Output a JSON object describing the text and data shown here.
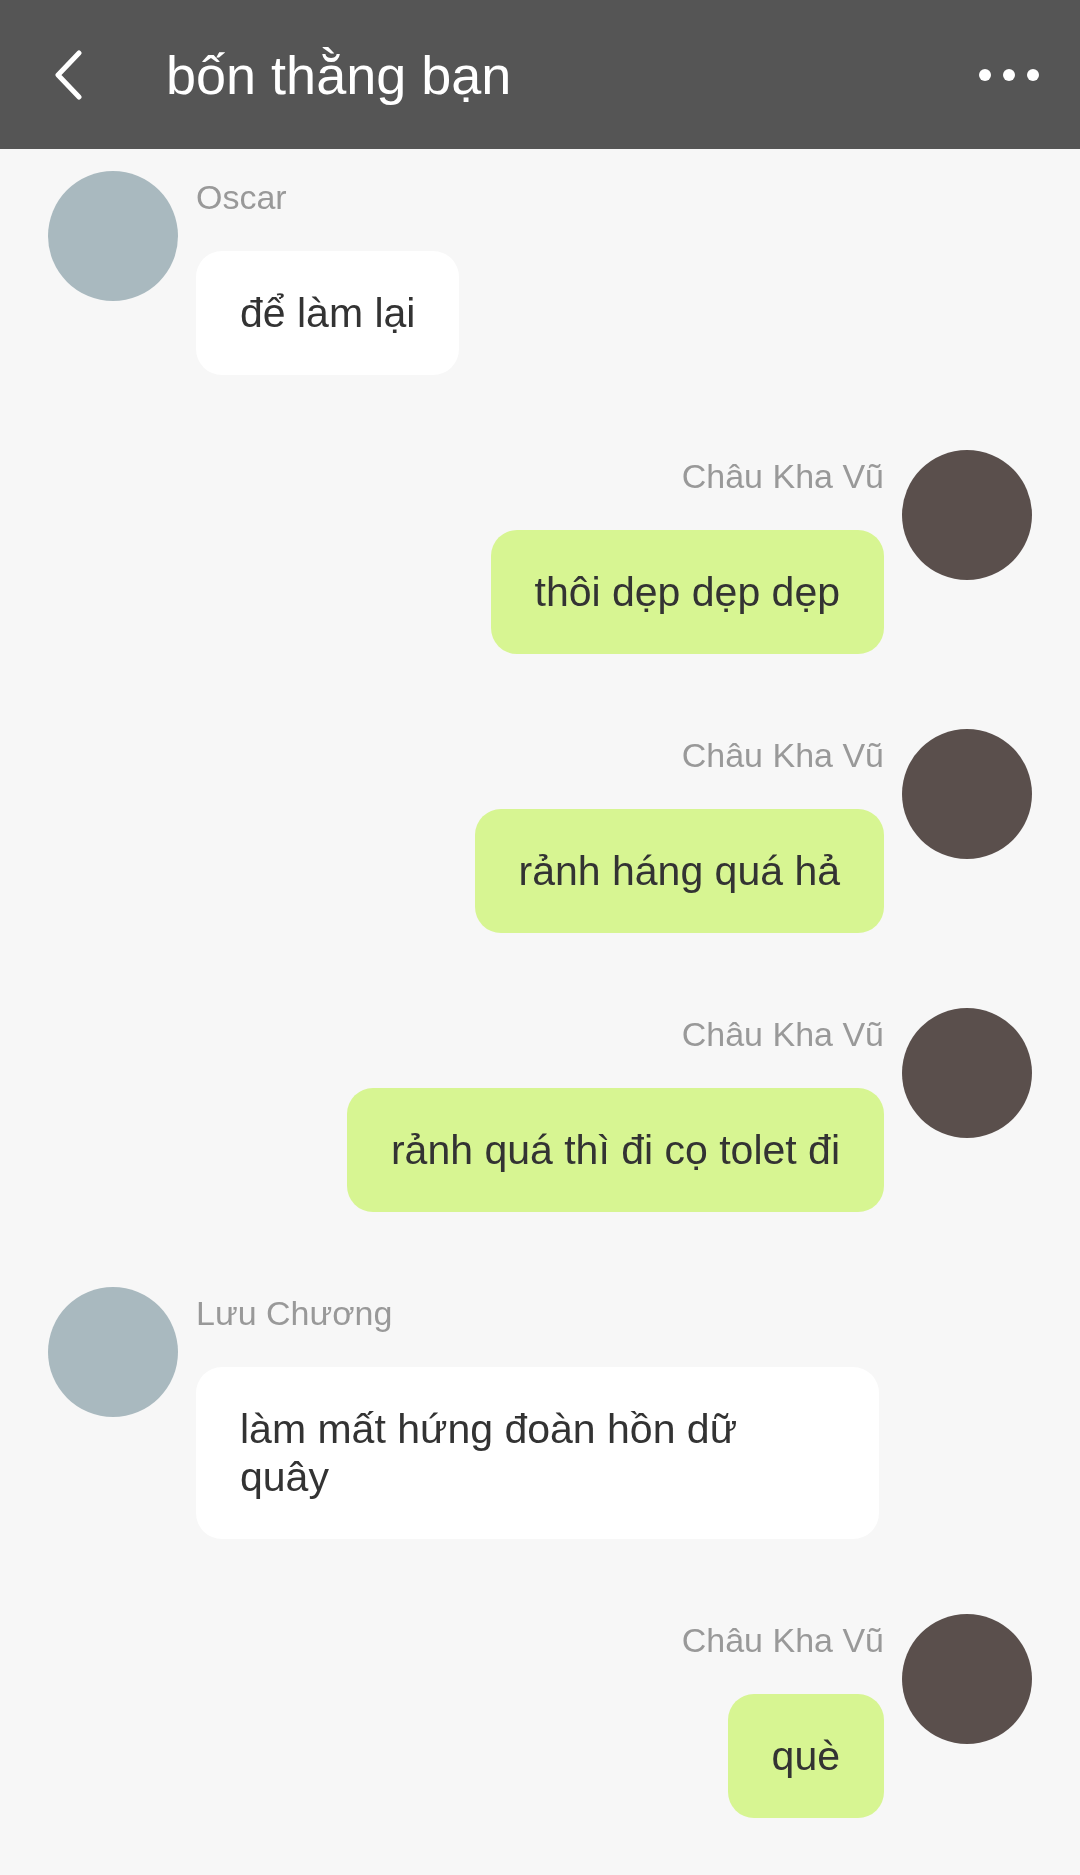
{
  "header": {
    "title": "bốn thằng bạn"
  },
  "messages": [
    {
      "kind": "incoming",
      "sender": "Oscar",
      "text": "để làm lại"
    },
    {
      "kind": "outgoing",
      "sender": "Châu Kha Vũ",
      "text": "thôi dẹp dẹp dẹp"
    },
    {
      "kind": "outgoing",
      "sender": "Châu Kha Vũ",
      "text": "rảnh háng quá hả"
    },
    {
      "kind": "outgoing",
      "sender": "Châu Kha Vũ",
      "text": "rảnh quá thì đi cọ tolet đi"
    },
    {
      "kind": "incoming",
      "sender": "Lưu Chương",
      "text": "làm mất hứng đoàn hồn dữ quây"
    },
    {
      "kind": "outgoing",
      "sender": "Châu Kha Vũ",
      "text": "què"
    }
  ]
}
